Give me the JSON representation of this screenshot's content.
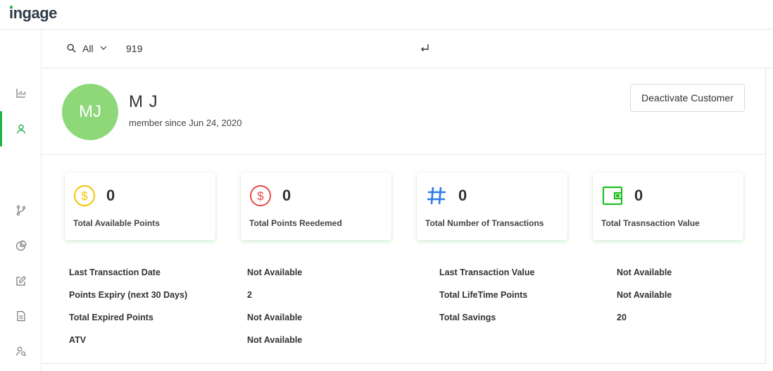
{
  "app": {
    "logo_text": "ingage",
    "brand_color": "#22b14c"
  },
  "sidebar": {
    "items": [
      {
        "icon": "bar-chart-icon",
        "active": false
      },
      {
        "icon": "user-icon",
        "active": true
      },
      {
        "icon": "branch-icon",
        "active": false
      },
      {
        "icon": "pie-chart-icon",
        "active": false
      },
      {
        "icon": "edit-icon",
        "active": false
      },
      {
        "icon": "document-icon",
        "active": false
      },
      {
        "icon": "users-icon",
        "active": false
      }
    ]
  },
  "search": {
    "scope": "All",
    "value": "919"
  },
  "customer": {
    "initials": "MJ",
    "name": "M J",
    "member_since": "member since Jun 24, 2020",
    "deactivate_label": "Deactivate Customer"
  },
  "cards": [
    {
      "value": "0",
      "label": "Total Available Points",
      "icon": "dollar-circle-icon",
      "color": "#f2c500"
    },
    {
      "value": "0",
      "label": "Total Points Reedemed",
      "icon": "dollar-circle-icon",
      "color": "#e84a4a"
    },
    {
      "value": "0",
      "label": "Total Number of Transactions",
      "icon": "hash-icon",
      "color": "#2d7be5"
    },
    {
      "value": "0",
      "label": "Total Trasnsaction Value",
      "icon": "wallet-icon",
      "color": "#22c022"
    }
  ],
  "details": {
    "left": [
      {
        "label": "Last Transaction Date",
        "value": "Not Available"
      },
      {
        "label": "Points Expiry (next 30 Days)",
        "value": "2"
      },
      {
        "label": "Total Expired Points",
        "value": "Not Available"
      },
      {
        "label": "ATV",
        "value": "Not Available"
      }
    ],
    "right": [
      {
        "label": "Last Transaction Value",
        "value": "Not Available"
      },
      {
        "label": "Total LifeTime Points",
        "value": "Not Available"
      },
      {
        "label": "Total Savings",
        "value": "20"
      }
    ]
  }
}
